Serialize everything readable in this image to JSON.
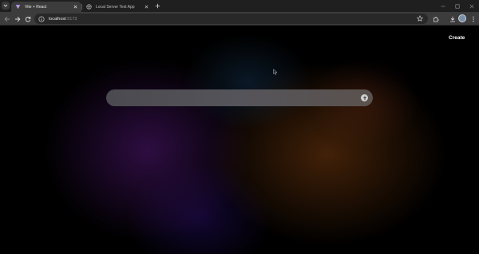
{
  "tabs": [
    {
      "title": "Vite + React",
      "active": true,
      "favicon": "vite-icon"
    },
    {
      "title": "Local Server Test App",
      "active": false,
      "favicon": "globe-icon"
    }
  ],
  "toolbar": {
    "url_host": "localhost",
    "url_port": ":5173",
    "icons": [
      "back-arrow-icon",
      "forward-arrow-icon",
      "reload-icon",
      "site-info-icon",
      "bookmark-star-icon",
      "extensions-icon",
      "download-icon",
      "kebab-menu-icon"
    ],
    "profile_initial": ""
  },
  "page": {
    "create_label": "Create",
    "search_placeholder": "",
    "search_value": ""
  },
  "colors": {
    "background": "#000000",
    "tab_active": "#3c3c3c",
    "toolbar": "#3c3c3c",
    "omnibox": "#282828",
    "search_bar": "#4f4e53"
  }
}
